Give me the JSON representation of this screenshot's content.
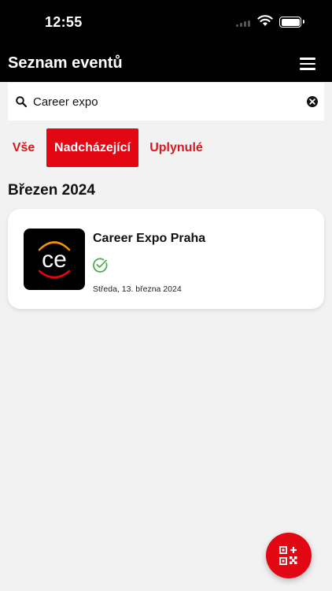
{
  "status_bar": {
    "time": "12:55",
    "icons": [
      "signal-icon",
      "wifi-icon",
      "battery-icon"
    ]
  },
  "header": {
    "title": "Seznam eventů",
    "menu_icon": "hamburger-menu-icon"
  },
  "search": {
    "value": "Career expo",
    "icon": "search-icon",
    "clear_icon": "clear-icon"
  },
  "filters": {
    "tabs": [
      {
        "label": "Vše",
        "selected": false
      },
      {
        "label": "Nadcházející",
        "selected": true
      },
      {
        "label": "Uplynulé",
        "selected": false
      }
    ]
  },
  "events": {
    "section_title": "Březen 2024",
    "items": [
      {
        "title": "Career Expo Praha",
        "logo_text": "ce",
        "status_icon": "check-circle-icon",
        "date": "Středa, 13. března 2024"
      }
    ]
  },
  "fab": {
    "icon": "qr-add-icon"
  },
  "colors": {
    "brand_red": "#e30613",
    "tab_text_red": "#d8171e",
    "check_green": "#4caf50",
    "header_bg": "#000000",
    "page_bg": "#f2f2f2"
  }
}
